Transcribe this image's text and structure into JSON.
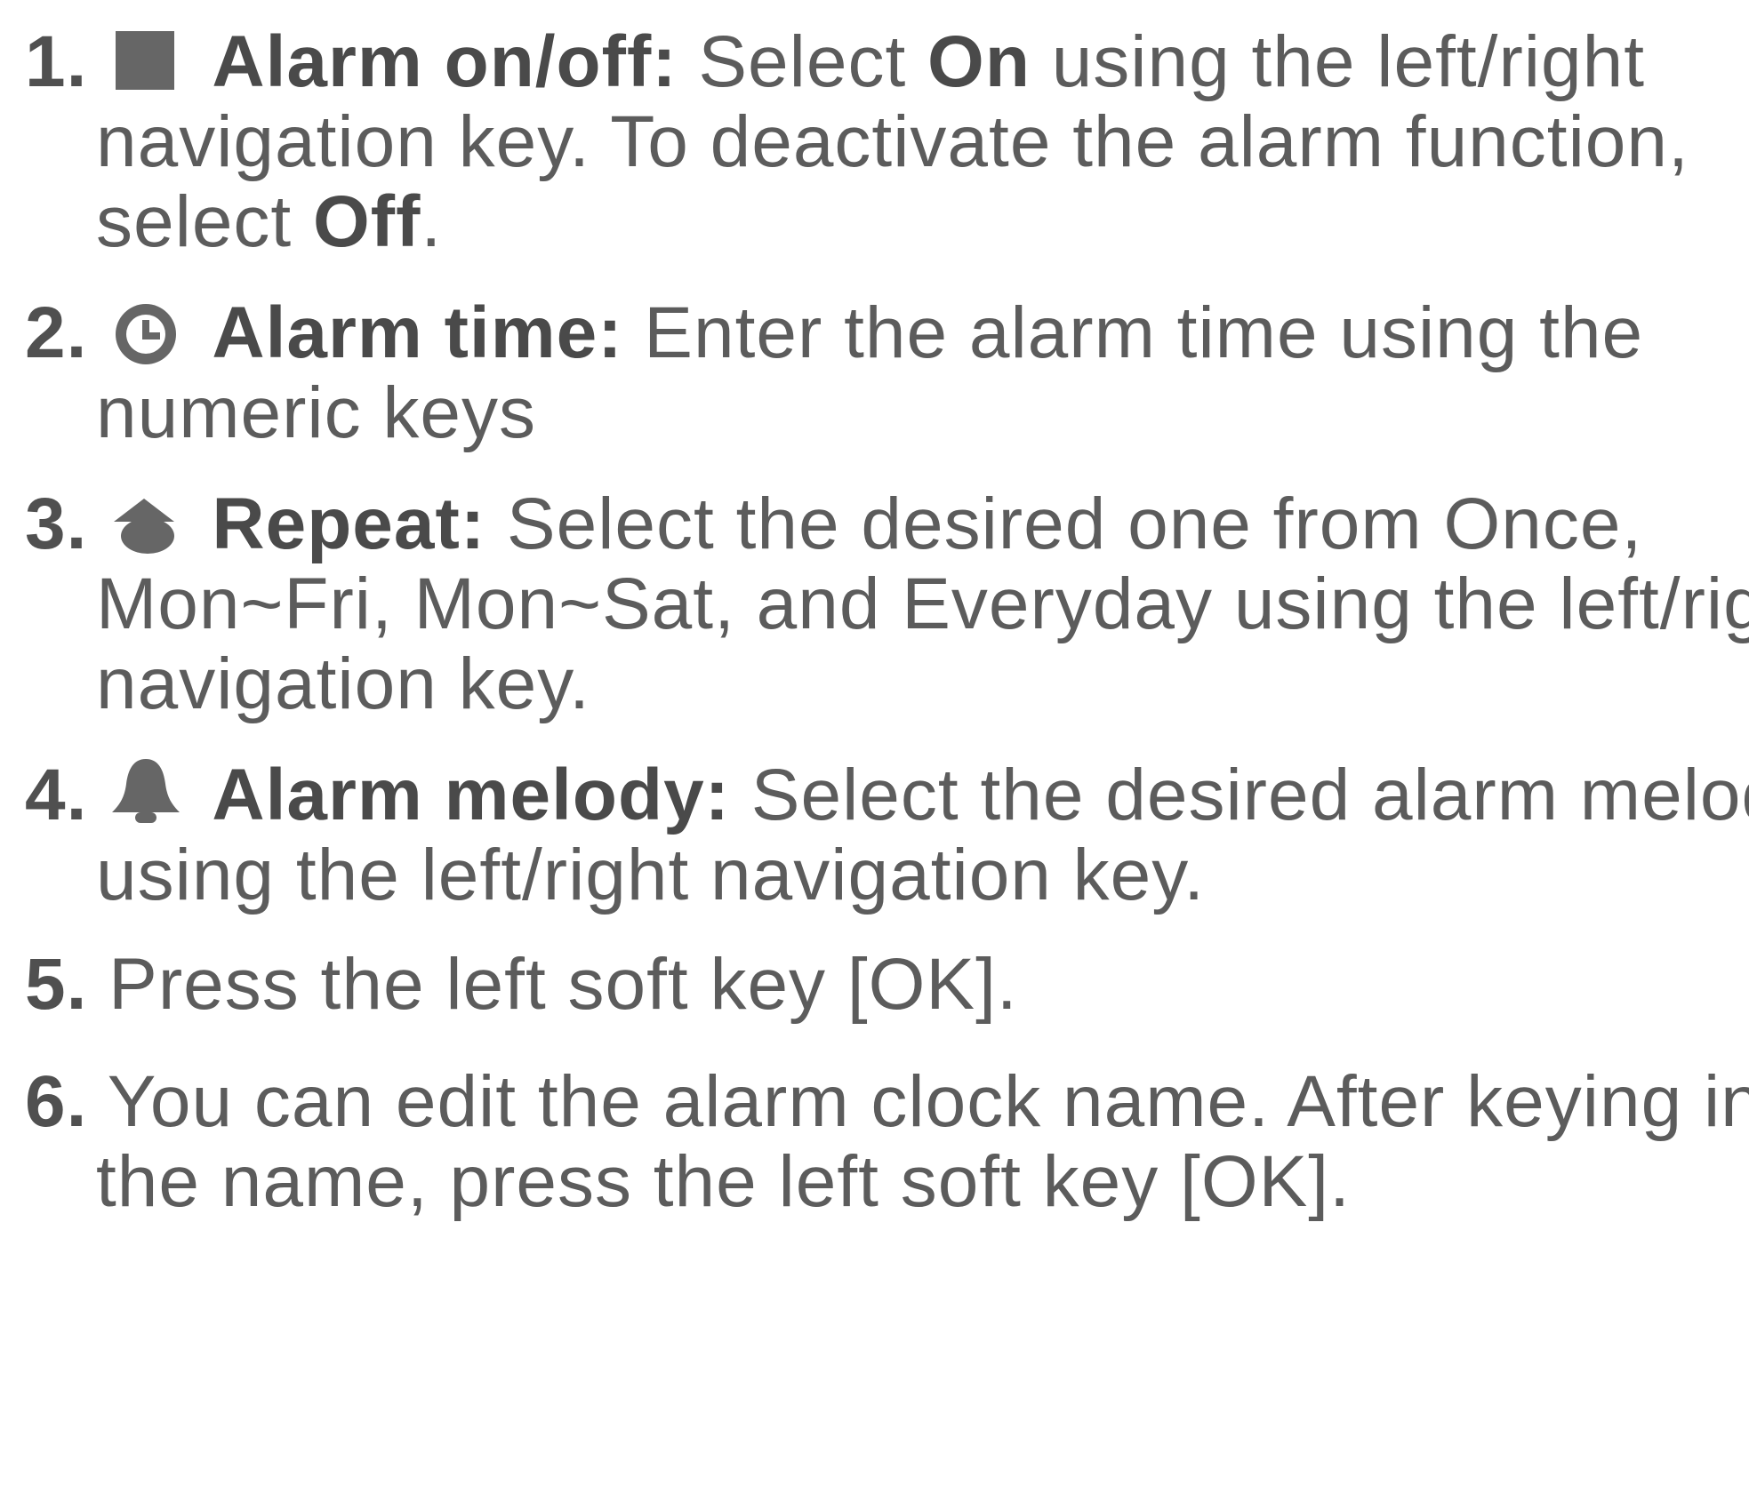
{
  "steps": [
    {
      "number": "1.",
      "icon": "alarm-on-off-icon",
      "lines": [
        {
          "bold_label": "Alarm on/off:",
          "pre": " Select ",
          "bold_mid": "On",
          "post": " using the left/right"
        },
        {
          "text": "navigation key. To deactivate the alarm function,"
        },
        {
          "pre": "select ",
          "bold": "Off",
          "post": "."
        }
      ]
    },
    {
      "number": "2.",
      "icon": "clock-icon",
      "lines": [
        {
          "bold_label": "Alarm time:",
          "post": " Enter the alarm time using the"
        },
        {
          "text": "numeric keys"
        }
      ]
    },
    {
      "number": "3.",
      "icon": "repeat-icon",
      "lines": [
        {
          "bold_label": "Repeat:",
          "post": " Select the desired one from Once,"
        },
        {
          "text": "Mon~Fri, Mon~Sat, and Everyday using the left/right"
        },
        {
          "text": "navigation key."
        }
      ]
    },
    {
      "number": "4.",
      "icon": "bell-icon",
      "lines": [
        {
          "bold_label": "Alarm melody:",
          "post": " Select the desired alarm melody"
        },
        {
          "text": "using the left/right navigation key."
        }
      ]
    },
    {
      "number": "5.",
      "lines": [
        {
          "text": " Press the left soft key [OK]."
        }
      ]
    },
    {
      "number": "6.",
      "lines": [
        {
          "text": " You can edit the alarm clock name. After keying in"
        },
        {
          "text": "the name, press the left soft key [OK]."
        }
      ]
    }
  ],
  "colors": {
    "text": "#5c5c5c",
    "bold_text": "#4a4a4a",
    "icon": "#666666",
    "background": "#ffffff"
  }
}
